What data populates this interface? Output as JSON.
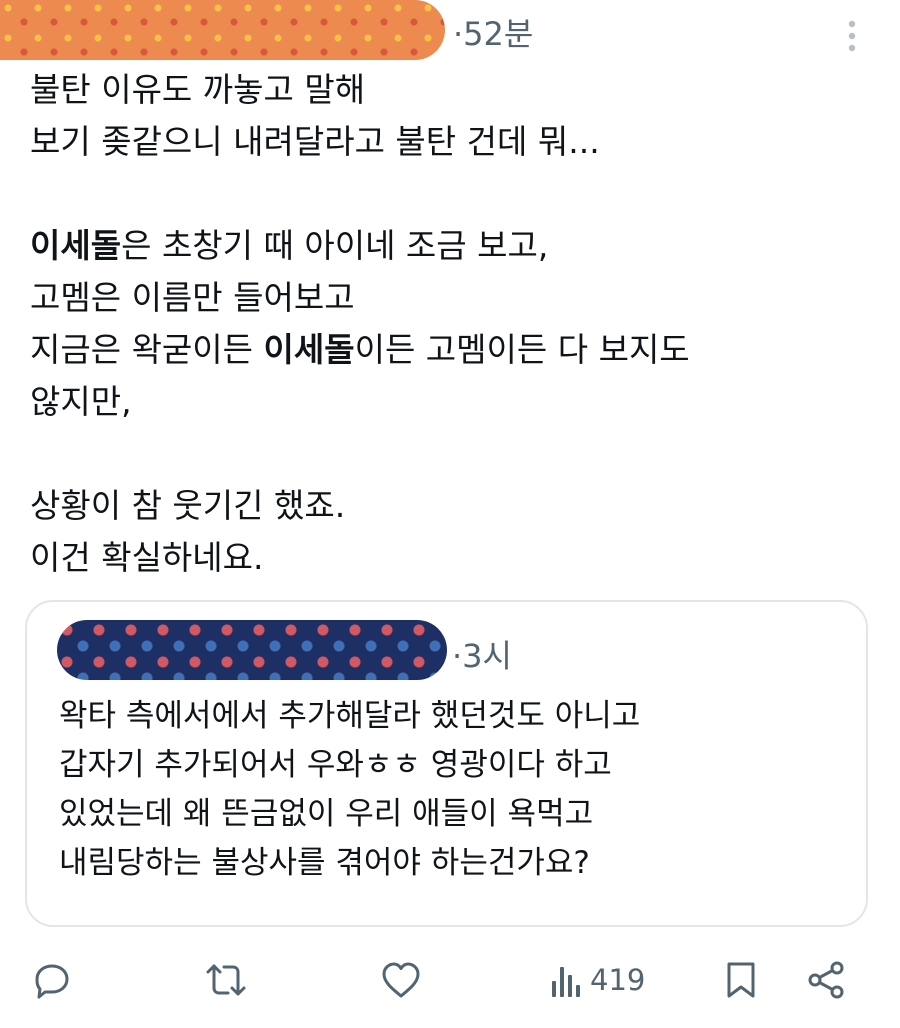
{
  "tweet": {
    "time": "52분",
    "body_lines": [
      [
        {
          "text": "불탄 이유도 까놓고 말해"
        }
      ],
      [
        {
          "text": "보기 좆같으니 내려달라고 불탄 건데 뭐..."
        }
      ],
      [
        {
          "text": ""
        }
      ],
      [
        {
          "text": "이세돌",
          "bold": true
        },
        {
          "text": "은 초창기 때 아이네 조금 보고,"
        }
      ],
      [
        {
          "text": "고멤은 이름만 들어보고"
        }
      ],
      [
        {
          "text": "지금은 왁굳이든 "
        },
        {
          "text": "이세돌",
          "bold": true
        },
        {
          "text": "이든 고멤이든 다 보지도"
        }
      ],
      [
        {
          "text": "않지만,"
        }
      ],
      [
        {
          "text": ""
        }
      ],
      [
        {
          "text": "상황이 참 웃기긴 했죠."
        }
      ],
      [
        {
          "text": "이건 확실하네요."
        }
      ]
    ]
  },
  "quote": {
    "time": "3시",
    "body": "왁타 측에서에서 추가해달라 했던것도 아니고\n갑자기 추가되어서 우와ㅎㅎ 영광이다 하고\n있었는데 왜 뜬금없이 우리 애들이 욕먹고\n내림당하는 불상사를 겪어야 하는건가요?"
  },
  "actions": {
    "views": "419",
    "icons": [
      "reply-icon",
      "retweet-icon",
      "like-icon",
      "views-icon",
      "bookmark-icon",
      "share-icon"
    ]
  },
  "colors": {
    "text": "#0f1419",
    "secondary": "#536471",
    "border": "#e1e6ea"
  }
}
